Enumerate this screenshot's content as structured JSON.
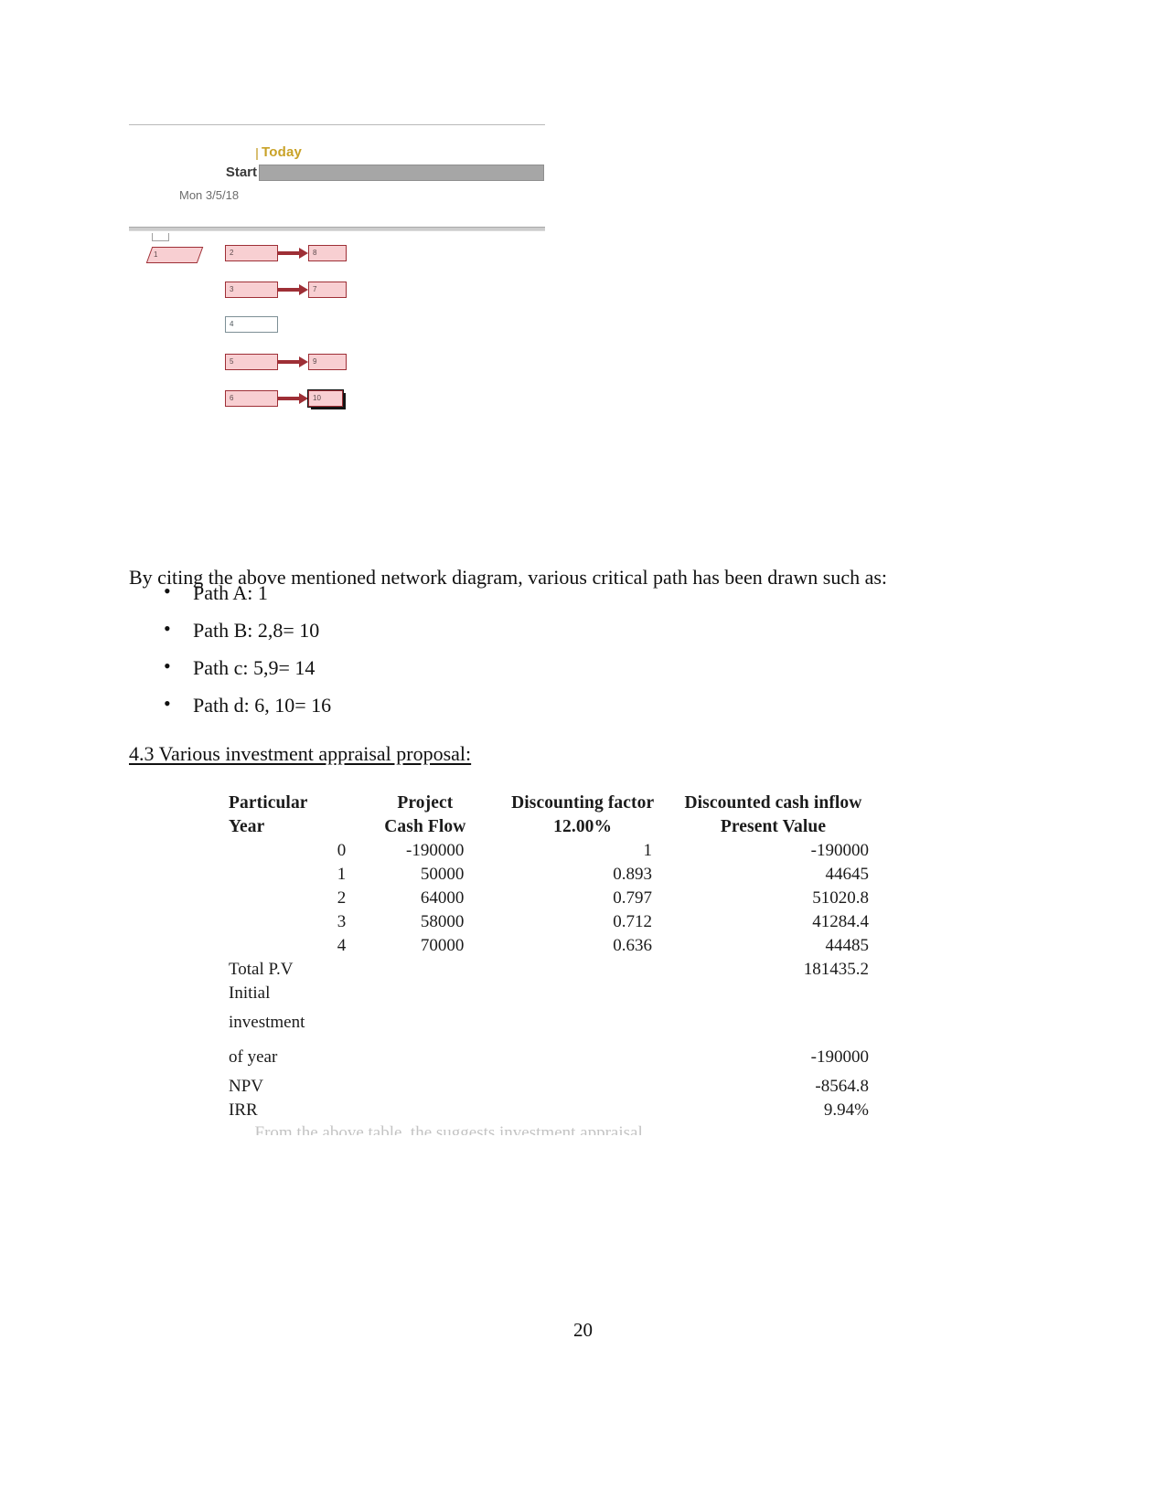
{
  "gantt": {
    "today_label": "Today",
    "start_label": "Start",
    "start_date": "Mon 3/5/18"
  },
  "network_diagram": {
    "nodes": [
      {
        "id": "1",
        "label": "1",
        "type": "start"
      },
      {
        "id": "2",
        "label": "2",
        "type": "critical"
      },
      {
        "id": "8",
        "label": "8",
        "type": "critical"
      },
      {
        "id": "3",
        "label": "3",
        "type": "critical"
      },
      {
        "id": "7",
        "label": "7",
        "type": "critical"
      },
      {
        "id": "4",
        "label": "4",
        "type": "noncritical"
      },
      {
        "id": "5",
        "label": "5",
        "type": "critical"
      },
      {
        "id": "9",
        "label": "9",
        "type": "critical"
      },
      {
        "id": "6",
        "label": "6",
        "type": "critical"
      },
      {
        "id": "10",
        "label": "10",
        "type": "critical-end"
      }
    ],
    "links": [
      {
        "from": "2",
        "to": "8"
      },
      {
        "from": "3",
        "to": "7"
      },
      {
        "from": "5",
        "to": "9"
      },
      {
        "from": "6",
        "to": "10"
      }
    ]
  },
  "body": {
    "intro": "By citing the above mentioned network diagram, various critical path has been drawn such as:",
    "bullets": [
      "Path A: 1",
      "Path B: 2,8= 10",
      "Path c: 5,9= 14",
      "Path d: 6, 10= 16"
    ],
    "heading_43": "4.3 Various investment appraisal proposal:"
  },
  "chart_data": {
    "type": "table",
    "title": "Various investment appraisal proposal",
    "columns": [
      {
        "line1": "Particular",
        "line2": "Year"
      },
      {
        "line1": "Project",
        "line2": "Cash Flow"
      },
      {
        "line1": "Discounting factor",
        "line2": "12.00%"
      },
      {
        "line1": "Discounted cash inflow",
        "line2": "Present Value"
      }
    ],
    "rows": [
      {
        "year": "0",
        "cash_flow": "-190000",
        "discount_factor": "1",
        "present_value": "-190000"
      },
      {
        "year": "1",
        "cash_flow": "50000",
        "discount_factor": "0.893",
        "present_value": "44645"
      },
      {
        "year": "2",
        "cash_flow": "64000",
        "discount_factor": "0.797",
        "present_value": "51020.8"
      },
      {
        "year": "3",
        "cash_flow": "58000",
        "discount_factor": "0.712",
        "present_value": "41284.4"
      },
      {
        "year": "4",
        "cash_flow": "70000",
        "discount_factor": "0.636",
        "present_value": "44485"
      }
    ],
    "summary": [
      {
        "label": "Total P.V",
        "value": "181435.2"
      },
      {
        "label": "Initial",
        "value": ""
      },
      {
        "label": "investment",
        "value": ""
      },
      {
        "label": "of year",
        "value": "-190000"
      },
      {
        "label": "NPV",
        "value": "-8564.8"
      },
      {
        "label": "IRR",
        "value": "9.94%"
      }
    ],
    "discount_rate": "12.00%",
    "npv": -8564.8,
    "irr": "9.94%",
    "total_pv": 181435.2,
    "initial_investment": -190000
  },
  "footer": {
    "page_number": "20"
  }
}
